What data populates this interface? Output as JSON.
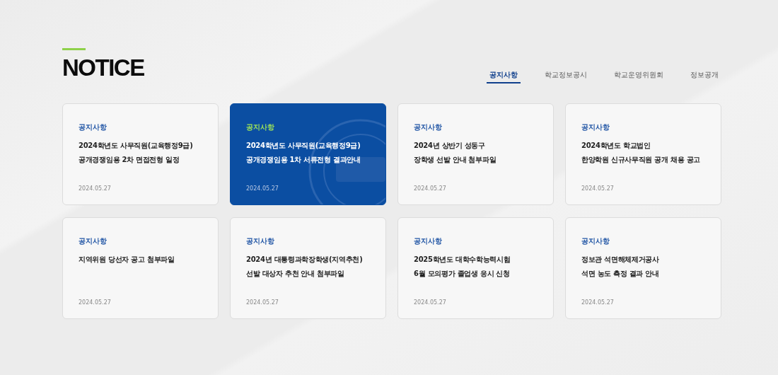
{
  "heading": {
    "title": "NOTICE"
  },
  "tabs": [
    {
      "label": "공지사항",
      "selected": true
    },
    {
      "label": "학교정보공시",
      "selected": false
    },
    {
      "label": "학교운영위원회",
      "selected": false
    },
    {
      "label": "정보공개",
      "selected": false
    }
  ],
  "cards": [
    {
      "category": "공지사항",
      "lines": [
        "2024학년도 사무직원(교육행정9급)",
        "공개경쟁임용 2차 면접전형 일정"
      ],
      "date": "2024.05.27",
      "selected": false
    },
    {
      "category": "공지사항",
      "lines": [
        "2024학년도 사무직원(교육행정9급)",
        "공개경쟁임용 1차 서류전형 결과안내"
      ],
      "date": "2024.05.27",
      "selected": true
    },
    {
      "category": "공지사항",
      "lines": [
        "2024년 상반기 성동구",
        "장학생 선발 안내 첨부파일"
      ],
      "date": "2024.05.27",
      "selected": false
    },
    {
      "category": "공지사항",
      "lines": [
        "2024학년도 학교법인",
        "한양학원 신규사무직원 공개 채용 공고"
      ],
      "date": "2024.05.27",
      "selected": false
    },
    {
      "category": "공지사항",
      "lines": [
        "지역위원 당선자 공고 첨부파일"
      ],
      "date": "2024.05.27",
      "selected": false
    },
    {
      "category": "공지사항",
      "lines": [
        "2024년 대통령과학장학생(지역추천)",
        "선발 대상자 추천 안내 첨부파일"
      ],
      "date": "2024.05.27",
      "selected": false
    },
    {
      "category": "공지사항",
      "lines": [
        "2025학년도 대학수학능력시험",
        "6월 모의평가 졸업생 응시 신청"
      ],
      "date": "2024.05.27",
      "selected": false
    },
    {
      "category": "공지사항",
      "lines": [
        "정보관 석면해체제거공사",
        "석면 농도 측정 결과 안내"
      ],
      "date": "2024.05.27",
      "selected": false
    }
  ]
}
